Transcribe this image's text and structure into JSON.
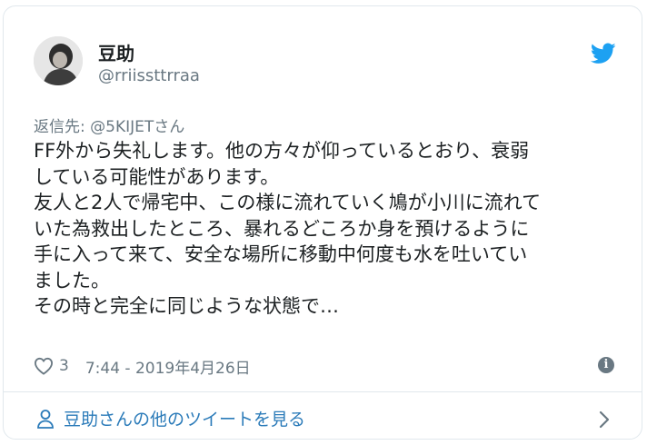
{
  "author": {
    "name": "豆助",
    "handle": "@rriissttrraa"
  },
  "reply": {
    "prefix": "返信先: ",
    "mention": "@5KIJETさん"
  },
  "tweet_lines": [
    "FF外から失礼します。他の方々が仰っているとおり、衰弱",
    "している可能性があります。",
    "友人と2人で帰宅中、この様に流れていく鳩が小川に流れて",
    "いた為救出したところ、暴れるどころか身を預けるように",
    "手に入って来て、安全な場所に移動中何度も水を吐いてい",
    "ました。",
    "その時と完全に同じような状態で…"
  ],
  "meta": {
    "likes": "3",
    "timestamp": "7:44 - 2019年4月26日"
  },
  "footer": {
    "more_label": "豆助さんの他のツイートを見る"
  },
  "icons": {
    "brand": "twitter-bird-icon",
    "like": "heart-icon",
    "info": "info-icon",
    "profile": "person-icon",
    "chevron": "chevron-right-icon"
  },
  "colors": {
    "twitter_blue": "#1da1f2",
    "link_blue": "#2b7bb9",
    "muted": "#697882",
    "text": "#1c2022",
    "border": "#e1e8ed"
  }
}
